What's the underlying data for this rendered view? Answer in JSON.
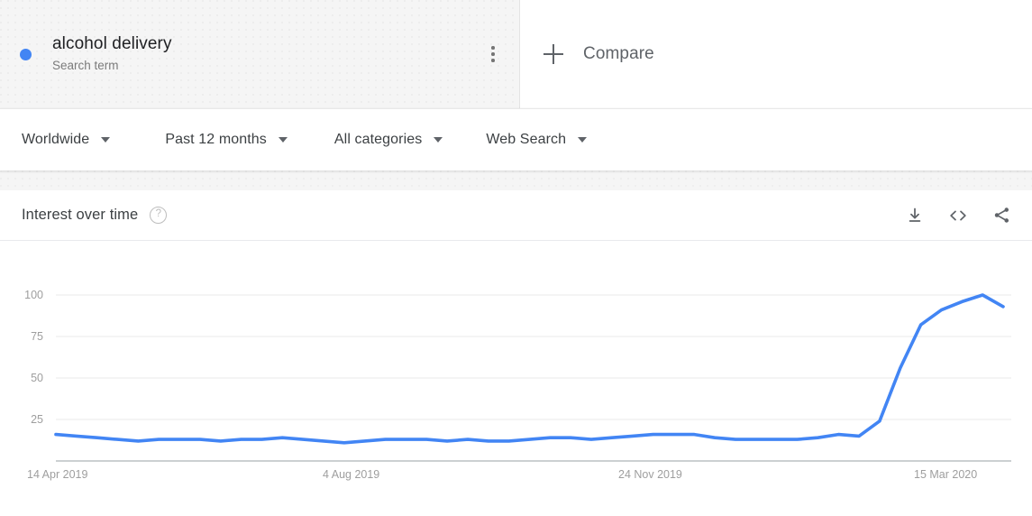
{
  "term": {
    "title": "alcohol delivery",
    "subtitle": "Search term",
    "dot_color": "#4285f4",
    "menu_icon": "kebab-menu-icon"
  },
  "compare": {
    "label": "Compare",
    "icon": "plus-icon"
  },
  "filters": [
    {
      "label": "Worldwide",
      "icon": "chevron-down-icon"
    },
    {
      "label": "Past 12 months",
      "icon": "chevron-down-icon"
    },
    {
      "label": "All categories",
      "icon": "chevron-down-icon"
    },
    {
      "label": "Web Search",
      "icon": "chevron-down-icon"
    }
  ],
  "chart_header": {
    "title": "Interest over time",
    "help_glyph": "?",
    "help_icon": "help-circle-icon",
    "actions": [
      {
        "name": "download-icon",
        "tooltip": "Download"
      },
      {
        "name": "embed-code-icon",
        "tooltip": "Embed"
      },
      {
        "name": "share-icon",
        "tooltip": "Share"
      }
    ]
  },
  "chart_data": {
    "type": "line",
    "title": "Interest over time",
    "xlabel": "",
    "ylabel": "",
    "ylim": [
      0,
      100
    ],
    "yticks": [
      25,
      50,
      75,
      100
    ],
    "ytick_labels": [
      "25",
      "50",
      "75",
      "100"
    ],
    "grid": true,
    "legend": "none",
    "line_color": "#4285f4",
    "xtick_labels": [
      "14 Apr 2019",
      "4 Aug 2019",
      "24 Nov 2019",
      "15 Mar 2020"
    ],
    "xtick_positions": [
      0,
      16,
      32,
      48
    ],
    "x_count": 53,
    "series": [
      {
        "name": "alcohol delivery",
        "color": "#4285f4",
        "values": [
          16,
          15,
          14,
          13,
          12,
          13,
          13,
          13,
          12,
          13,
          13,
          14,
          13,
          12,
          11,
          12,
          13,
          13,
          13,
          12,
          13,
          12,
          12,
          13,
          14,
          14,
          13,
          14,
          15,
          16,
          16,
          16,
          14,
          13,
          13,
          13,
          13,
          14,
          16,
          15,
          24,
          56,
          82,
          91,
          96,
          100,
          93
        ]
      }
    ]
  }
}
